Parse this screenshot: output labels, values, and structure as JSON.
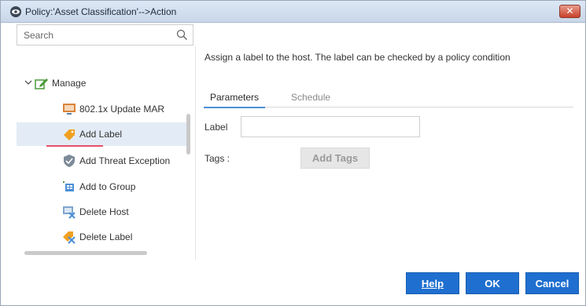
{
  "window": {
    "title": "Policy:'Asset Classification'-->Action",
    "close_label": "✕"
  },
  "search": {
    "placeholder": "Search"
  },
  "tree": {
    "group_label": "Manage",
    "items": [
      {
        "label": "802.1x Update MAR",
        "icon": "monitor-icon"
      },
      {
        "label": "Add Label",
        "icon": "tag-icon",
        "selected": true
      },
      {
        "label": "Add Threat Exception",
        "icon": "shield-icon"
      },
      {
        "label": "Add to Group",
        "icon": "group-icon"
      },
      {
        "label": "Delete Host",
        "icon": "delete-host-icon"
      },
      {
        "label": "Delete Label",
        "icon": "delete-tag-icon"
      }
    ]
  },
  "main": {
    "description": "Assign a label to the host. The label can be checked by a policy condition",
    "tabs": [
      {
        "label": "Parameters",
        "active": true
      },
      {
        "label": "Schedule",
        "active": false
      }
    ],
    "label_field": {
      "label": "Label",
      "value": ""
    },
    "tags_field": {
      "label": "Tags :"
    },
    "add_tags_label": "Add Tags"
  },
  "footer": {
    "help_label": "Help",
    "ok_label": "OK",
    "cancel_label": "Cancel"
  },
  "colors": {
    "accent": "#1f6fd0",
    "selection": "#e3ecf6",
    "underline": "#e8506a"
  }
}
